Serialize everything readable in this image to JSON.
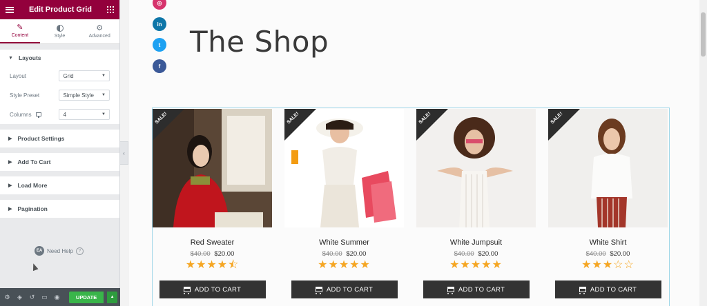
{
  "panel": {
    "title": "Edit Product Grid",
    "tabs": [
      {
        "label": "Content"
      },
      {
        "label": "Style"
      },
      {
        "label": "Advanced"
      }
    ],
    "layouts_section": "Layouts",
    "controls": [
      {
        "label": "Layout",
        "value": "Grid"
      },
      {
        "label": "Style Preset",
        "value": "Simple Style"
      },
      {
        "label": "Columns",
        "value": "4"
      }
    ],
    "collapsed_sections": [
      "Product Settings",
      "Add To Cart",
      "Load More",
      "Pagination"
    ],
    "help_badge": "EA",
    "need_help": "Need Help",
    "help_q": "?",
    "update_label": "UPDATE"
  },
  "preview": {
    "title": "The Shop",
    "social": {
      "linkedin": "in",
      "twitter": "t",
      "facebook": "f"
    },
    "sale_label": "SALE!",
    "cart_label": "ADD TO CART",
    "products": [
      {
        "name": "Red Sweater",
        "old_price": "$40.00",
        "price": "$20.00",
        "rating": 4.5
      },
      {
        "name": "White Summer",
        "old_price": "$40.00",
        "price": "$20.00",
        "rating": 5
      },
      {
        "name": "White Jumpsuit",
        "old_price": "$40.00",
        "price": "$20.00",
        "rating": 5
      },
      {
        "name": "White Shirt",
        "old_price": "$40.00",
        "price": "$20.00",
        "rating": 3
      }
    ]
  },
  "colors": {
    "brand": "#93003c",
    "update": "#39b54a",
    "star": "#f5a623",
    "button_dark": "#333333"
  }
}
